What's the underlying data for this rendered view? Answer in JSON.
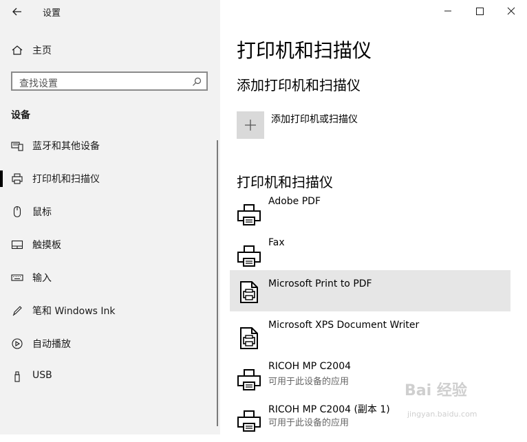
{
  "window": {
    "title": "设置"
  },
  "sidebar": {
    "home_label": "主页",
    "search_placeholder": "查找设置",
    "section_title": "设备",
    "items": [
      {
        "label": "蓝牙和其他设备",
        "icon": "bluetooth-devices-icon"
      },
      {
        "label": "打印机和扫描仪",
        "icon": "printer-icon",
        "active": true
      },
      {
        "label": "鼠标",
        "icon": "mouse-icon"
      },
      {
        "label": "触摸板",
        "icon": "touchpad-icon"
      },
      {
        "label": "输入",
        "icon": "keyboard-icon"
      },
      {
        "label": "笔和 Windows Ink",
        "icon": "pen-icon"
      },
      {
        "label": "自动播放",
        "icon": "autoplay-icon"
      },
      {
        "label": "USB",
        "icon": "usb-icon"
      }
    ]
  },
  "main": {
    "title": "打印机和扫描仪",
    "add_section_title": "添加打印机和扫描仪",
    "add_button_label": "添加打印机或扫描仪",
    "list_section_title": "打印机和扫描仪",
    "printers": [
      {
        "name": "Adobe PDF",
        "status": "",
        "icon": "printer-icon"
      },
      {
        "name": "Fax",
        "status": "",
        "icon": "printer-icon"
      },
      {
        "name": "Microsoft Print to PDF",
        "status": "",
        "icon": "document-printer-icon",
        "selected": true
      },
      {
        "name": "Microsoft XPS Document Writer",
        "status": "",
        "icon": "document-printer-icon"
      },
      {
        "name": "RICOH MP C2004",
        "status": "可用于此设备的应用",
        "icon": "printer-icon"
      },
      {
        "name": "RICOH MP C2004 (副本 1)",
        "status": "可用于此设备的应用",
        "icon": "printer-icon"
      }
    ]
  },
  "watermark": {
    "text": "Bai 经验",
    "url_text": "jingyan.baidu.com"
  }
}
